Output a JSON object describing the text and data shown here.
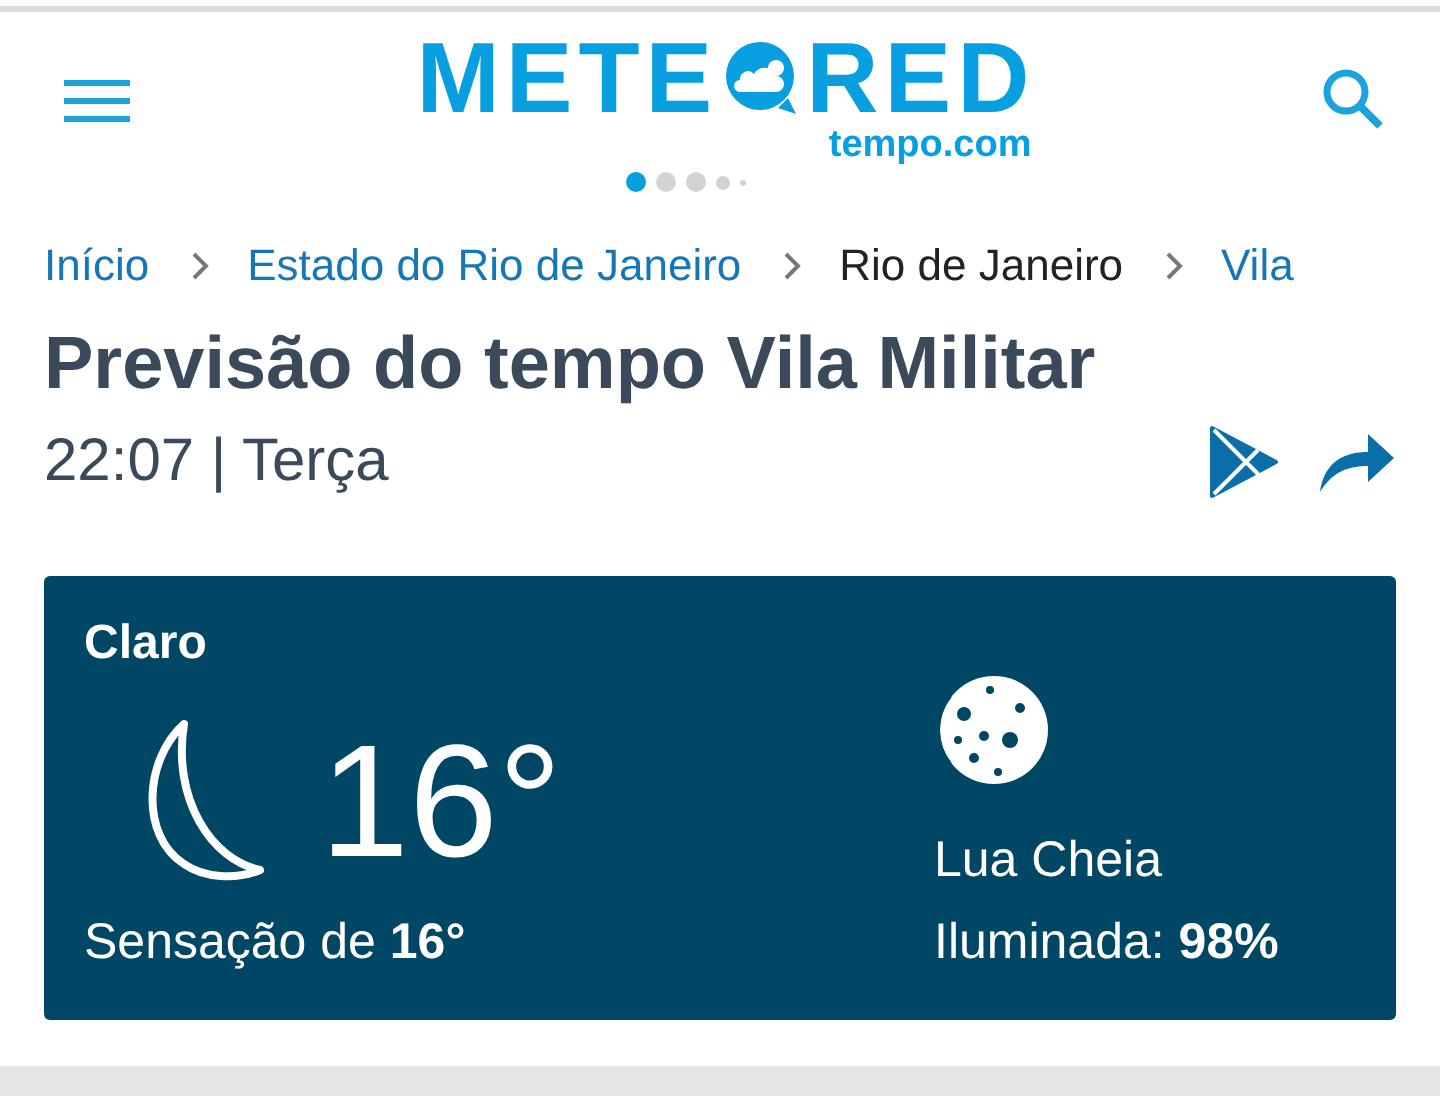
{
  "header": {
    "logo_left": "METE",
    "logo_right": "RED",
    "logo_sub": "tempo.com",
    "dots": [
      {
        "selected": true
      },
      {
        "selected": false
      },
      {
        "selected": false
      },
      {
        "selected": false
      },
      {
        "selected": false
      }
    ]
  },
  "breadcrumbs": [
    {
      "label": "Início",
      "current": false
    },
    {
      "label": "Estado do Rio de Janeiro",
      "current": false
    },
    {
      "label": "Rio de Janeiro",
      "current": true
    },
    {
      "label": "Vila",
      "current": false
    }
  ],
  "title": "Previsão do tempo Vila Militar",
  "time": "22:07 | Terça",
  "current": {
    "condition": "Claro",
    "temperature": "16°",
    "feels_like": "Sensação de **16°**",
    "moon_phase": "Lua Cheia",
    "illumination": "Iluminada: **98%**"
  }
}
